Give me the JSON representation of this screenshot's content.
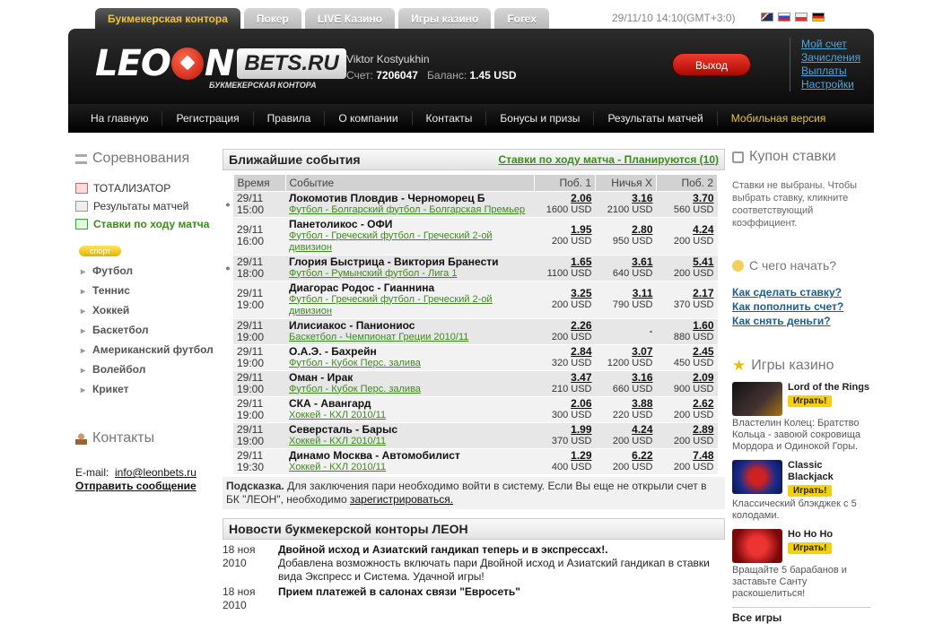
{
  "top": {
    "tabs": [
      "Букмекерская контора",
      "Покер",
      "LIVE Казино",
      "Игры казино",
      "Forex"
    ],
    "datetime": "29/11/10 14:10(GMT+3:0)"
  },
  "header": {
    "logo_left": "LEO",
    "logo_right": "N",
    "logo_bets": "BETS.RU",
    "logo_sub": "БУКМЕКЕРСКАЯ КОНТОРА",
    "user_name": "Viktor Kostyukhin",
    "account_label": "Счет:",
    "account_no": "7206047",
    "balance_label": "Баланс:",
    "balance": "1.45 USD",
    "logout": "Выход",
    "links": [
      "Мой счет",
      "Зачисления",
      "Выплаты",
      "Настройки"
    ]
  },
  "nav": [
    "На главную",
    "Регистрация",
    "Правила",
    "О компании",
    "Контакты",
    "Бонусы и призы",
    "Результаты матчей",
    "Мобильная версия"
  ],
  "left": {
    "title": "Соревнования",
    "links": [
      "ТОТАЛИЗАТОР",
      "Результаты матчей",
      "Ставки по ходу матча"
    ],
    "badge": "спорт",
    "sports": [
      "Футбол",
      "Теннис",
      "Хоккей",
      "Баскетбол",
      "Американский футбол",
      "Волейбол",
      "Крикет"
    ],
    "contacts_title": "Контакты",
    "email_label": "E-mail:",
    "email": "info@leonbets.ru",
    "send": "Отправить сообщение"
  },
  "events": {
    "title": "Ближайшие события",
    "link": "Ставки по ходу матча - Планируются (10)",
    "headers": [
      "Время",
      "Событие",
      "Поб. 1",
      "Ничья X",
      "Поб. 2"
    ],
    "rows": [
      {
        "d": "29/11",
        "t": "15:00",
        "m": "Локомотив Пловдив - Черноморец Б",
        "l": "Футбол - Болгарский футбол - Болгарская Премьер",
        "o1": "2.06",
        "s1": "1600 USD",
        "ox": "3.16",
        "sx": "2100 USD",
        "o2": "3.70",
        "s2": "560 USD",
        "dot": true
      },
      {
        "d": "29/11",
        "t": "16:00",
        "m": "Панетоликос - ОФИ",
        "l": "Футбол - Греческий футбол - Греческий 2-ой дивизион",
        "o1": "1.95",
        "s1": "200 USD",
        "ox": "2.80",
        "sx": "950 USD",
        "o2": "4.24",
        "s2": "200 USD",
        "dot": false
      },
      {
        "d": "29/11",
        "t": "18:00",
        "m": "Глория Быстрица - Виктория Бранести",
        "l": "Футбол - Румынский футбол - Лига 1",
        "o1": "1.65",
        "s1": "1100 USD",
        "ox": "3.61",
        "sx": "640 USD",
        "o2": "5.41",
        "s2": "200 USD",
        "dot": true
      },
      {
        "d": "29/11",
        "t": "19:00",
        "m": "Диагорас Родос - Гианнина",
        "l": "Футбол - Греческий футбол - Греческий 2-ой дивизион",
        "o1": "3.25",
        "s1": "200 USD",
        "ox": "3.11",
        "sx": "790 USD",
        "o2": "2.17",
        "s2": "370 USD",
        "dot": false
      },
      {
        "d": "29/11",
        "t": "19:00",
        "m": "Илисиакос - Паниониос",
        "l": "Баскетбол - Чемпионат Греции 2010/11",
        "o1": "2.26",
        "s1": "200 USD",
        "ox": "-",
        "sx": "",
        "o2": "1.60",
        "s2": "880 USD",
        "dot": false
      },
      {
        "d": "29/11",
        "t": "19:00",
        "m": "О.А.Э. - Бахрейн",
        "l": "Футбол - Кубок Перс. залива",
        "o1": "2.84",
        "s1": "320 USD",
        "ox": "3.07",
        "sx": "1200 USD",
        "o2": "2.45",
        "s2": "450 USD",
        "dot": false
      },
      {
        "d": "29/11",
        "t": "19:00",
        "m": "Оман - Ирак",
        "l": "Футбол - Кубок Перс. залива",
        "o1": "3.47",
        "s1": "210 USD",
        "ox": "3.16",
        "sx": "660 USD",
        "o2": "2.09",
        "s2": "900 USD",
        "dot": false
      },
      {
        "d": "29/11",
        "t": "19:00",
        "m": "СКА - Авангард",
        "l": "Хоккей - КХЛ 2010/11",
        "o1": "2.06",
        "s1": "300 USD",
        "ox": "3.88",
        "sx": "220 USD",
        "o2": "2.62",
        "s2": "200 USD",
        "dot": false
      },
      {
        "d": "29/11",
        "t": "19:00",
        "m": "Северсталь - Барыс",
        "l": "Хоккей - КХЛ 2010/11",
        "o1": "1.99",
        "s1": "370 USD",
        "ox": "4.24",
        "sx": "200 USD",
        "o2": "2.89",
        "s2": "200 USD",
        "dot": false
      },
      {
        "d": "29/11",
        "t": "19:30",
        "m": "Динамо Москва - Автомобилист",
        "l": "Хоккей - КХЛ 2010/11",
        "o1": "1.29",
        "s1": "400 USD",
        "ox": "6.22",
        "sx": "200 USD",
        "o2": "7.48",
        "s2": "200 USD",
        "dot": false
      }
    ],
    "hint_bold": "Подсказка.",
    "hint_text": "Для заключения пари необходимо войти в систему. Если Вы еще не открыли счет в БК \"ЛЕОН\", необходимо",
    "hint_link": "зарегистрироваться."
  },
  "news": {
    "title": "Новости букмекерской конторы ЛЕОН",
    "items": [
      {
        "date1": "18 ноя",
        "date2": "2010",
        "title": "Двойной исход и Азиатский гандикап теперь и в экспрессах!.",
        "text": "Добавлена возможность включать пари Двойной исход и Азиатский гандикап в ставки вида Экспресс и Система. Удачной игры!"
      },
      {
        "date1": "18 ноя",
        "date2": "2010",
        "title": "Прием платежей в салонах связи \"Евросеть\"",
        "text": ""
      }
    ]
  },
  "right": {
    "coupon_title": "Купон ставки",
    "coupon_text": "Ставки не выбраны. Чтобы выбрать ставку, кликните соответствующий коэффициент.",
    "start_title": "С чего начать?",
    "help": [
      "Как сделать ставку?",
      "Как пополнить счет?",
      "Как снять деньги?"
    ],
    "games_title": "Игры казино",
    "play": "Играть!",
    "games": [
      {
        "name": "Lord of the Rings",
        "desc": "Властелин Колец: Братство Кольца - завоюй сокровища Мордора и Одинокой Горы."
      },
      {
        "name": "Classic Blackjack",
        "desc": "Классический блэкджек с 5 колодами."
      },
      {
        "name": "Ho Ho Ho",
        "desc": "Вращайте 5 барабанов и заставьте Санту раскошелиться!"
      }
    ],
    "all_games": "Все игры"
  }
}
